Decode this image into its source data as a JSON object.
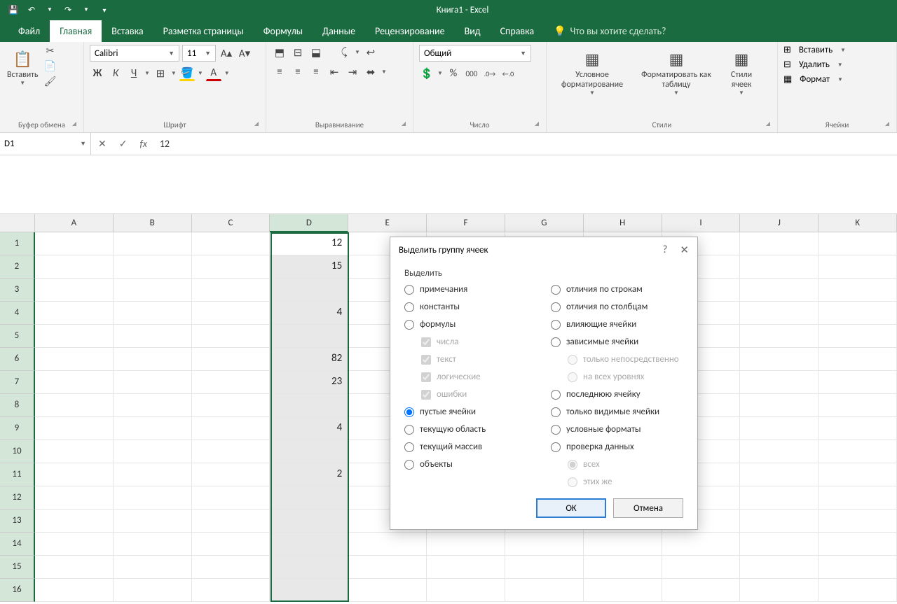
{
  "app": {
    "title": "Книга1  -  Excel"
  },
  "qat": {
    "save": "💾",
    "undo": "↶",
    "redo": "↷"
  },
  "tabs": {
    "file": "Файл",
    "home": "Главная",
    "insert": "Вставка",
    "layout": "Разметка страницы",
    "formulas": "Формулы",
    "data": "Данные",
    "review": "Рецензирование",
    "view": "Вид",
    "help": "Справка",
    "tell": "Что вы хотите сделать?"
  },
  "ribbon": {
    "clipboard": {
      "paste": "Вставить",
      "label": "Буфер обмена"
    },
    "font": {
      "name": "Calibri",
      "size": "11",
      "label": "Шрифт",
      "bold": "Ж",
      "italic": "К",
      "underline": "Ч"
    },
    "align": {
      "label": "Выравнивание"
    },
    "number": {
      "format": "Общий",
      "label": "Число"
    },
    "styles": {
      "cond": "Условное форматирование",
      "table": "Форматировать как таблицу",
      "cell": "Стили ячеек",
      "label": "Стили"
    },
    "cells": {
      "insert": "Вставить",
      "delete": "Удалить",
      "format": "Формат",
      "label": "Ячейки"
    }
  },
  "namebox": "D1",
  "formula": "12",
  "columns": [
    "A",
    "B",
    "C",
    "D",
    "E",
    "F",
    "G",
    "H",
    "I",
    "J",
    "K"
  ],
  "rowcount": 16,
  "data_col_index": 3,
  "cells": {
    "1": "12",
    "2": "15",
    "4": "4",
    "6": "82",
    "7": "23",
    "9": "4",
    "11": "2"
  },
  "dialog": {
    "title": "Выделить группу ячеек",
    "section": "Выделить",
    "help": "?",
    "close": "✕",
    "left": [
      {
        "k": "notes",
        "t": "примечания",
        "kind": "radio"
      },
      {
        "k": "const",
        "t": "константы",
        "kind": "radio"
      },
      {
        "k": "formulas",
        "t": "формулы",
        "kind": "radio"
      },
      {
        "k": "cnum",
        "t": "числа",
        "kind": "check",
        "sub": true,
        "dis": true,
        "checked": true
      },
      {
        "k": "ctext",
        "t": "текст",
        "kind": "check",
        "sub": true,
        "dis": true,
        "checked": true
      },
      {
        "k": "clog",
        "t": "логические",
        "kind": "check",
        "sub": true,
        "dis": true,
        "checked": true
      },
      {
        "k": "cerr",
        "t": "ошибки",
        "kind": "check",
        "sub": true,
        "dis": true,
        "checked": true
      },
      {
        "k": "blanks",
        "t": "пустые ячейки",
        "kind": "radio",
        "checked": true
      },
      {
        "k": "region",
        "t": "текущую область",
        "kind": "radio"
      },
      {
        "k": "array",
        "t": "текущий массив",
        "kind": "radio"
      },
      {
        "k": "objects",
        "t": "объекты",
        "kind": "radio"
      }
    ],
    "right": [
      {
        "k": "rowdiff",
        "t": "отличия по строкам",
        "kind": "radio"
      },
      {
        "k": "coldiff",
        "t": "отличия по столбцам",
        "kind": "radio"
      },
      {
        "k": "prec",
        "t": "влияющие ячейки",
        "kind": "radio"
      },
      {
        "k": "dep",
        "t": "зависимые ячейки",
        "kind": "radio"
      },
      {
        "k": "direct",
        "t": "только непосредственно",
        "kind": "radio",
        "sub": true,
        "dis": true,
        "checked": true
      },
      {
        "k": "all",
        "t": "на всех уровнях",
        "kind": "radio",
        "sub": true,
        "dis": true
      },
      {
        "k": "last",
        "t": "последнюю ячейку",
        "kind": "radio"
      },
      {
        "k": "visible",
        "t": "только видимые ячейки",
        "kind": "radio"
      },
      {
        "k": "cf",
        "t": "условные форматы",
        "kind": "radio"
      },
      {
        "k": "dv",
        "t": "проверка данных",
        "kind": "radio"
      },
      {
        "k": "dvall",
        "t": "всех",
        "kind": "radio",
        "sub": true,
        "dis": true,
        "checked": true
      },
      {
        "k": "dvsame",
        "t": "этих же",
        "kind": "radio",
        "sub": true,
        "dis": true
      }
    ],
    "ok": "OK",
    "cancel": "Отмена"
  }
}
